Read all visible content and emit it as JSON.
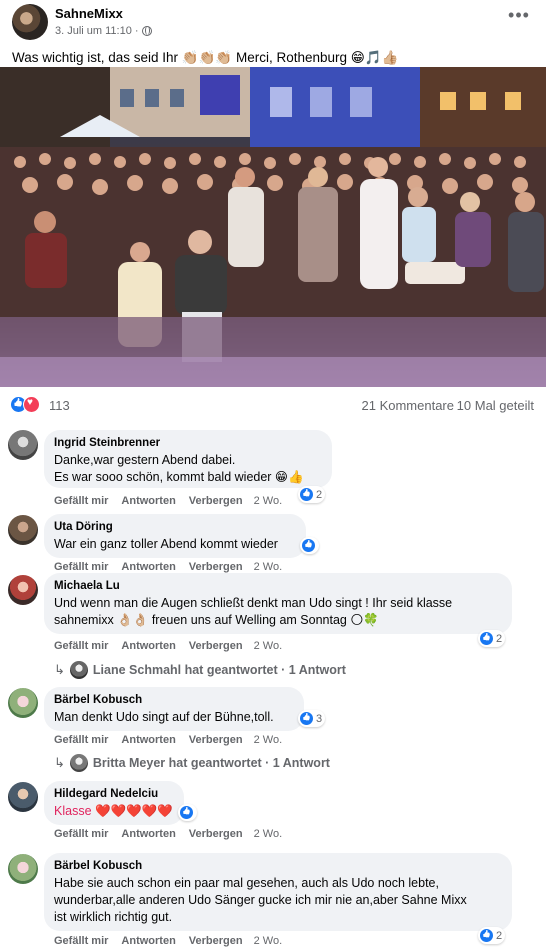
{
  "post": {
    "page_name": "SahneMixx",
    "date": "3. Juli um 11:10",
    "dot": "·",
    "text": "Was wichtig ist, das seid Ihr 👏🏼👏🏼👏🏼 Merci, Rothenburg 😁🎵👍🏼",
    "more_icon": "more-options-icon"
  },
  "stats": {
    "reaction_count": "113",
    "comments": "21 Kommentare",
    "shares": "10 Mal geteilt"
  },
  "actions": {
    "like": "Gefällt mir",
    "reply": "Antworten",
    "hide": "Verbergen"
  },
  "comments": [
    {
      "name": "Ingrid Steinbrenner",
      "line1": "Danke,war gestern Abend dabei.",
      "line2": "Es war sooo schön, kommt bald wieder 😁👍",
      "time": "2 Wo.",
      "reactions": "2"
    },
    {
      "name": "Uta Döring",
      "line1": "War ein ganz toller Abend kommt wieder",
      "time": "2 Wo."
    },
    {
      "name": "Michaela Lu",
      "line1": "Und wenn man die Augen schließt denkt man Udo singt ! Ihr seid klasse",
      "line2": "sahnemixx 👌🏼👌🏼 freuen uns auf Welling am Sonntag 🌕🍀",
      "time": "2 Wo.",
      "reactions": "2",
      "reply_thread": "Liane Schmahl hat geantwortet · 1 Antwort"
    },
    {
      "name": "Bärbel Kobusch",
      "line1": "Man denkt Udo singt auf der Bühne,toll.",
      "time": "2 Wo.",
      "reactions": "3",
      "reply_thread": "Britta Meyer hat geantwortet · 1 Antwort"
    },
    {
      "name": "Hildegard Nedelciu",
      "line1": "Klasse ❤️❤️❤️❤️❤️",
      "time": "2 Wo."
    },
    {
      "name": "Bärbel Kobusch",
      "line1": "Habe sie auch schon ein paar mal gesehen, auch als Udo noch lebte,",
      "line2": "wunderbar,alle anderen Udo Sänger gucke ich mir nie an,aber Sahne Mixx",
      "line3": "ist wirklich richtig gut.",
      "time": "2 Wo.",
      "reactions": "2"
    }
  ],
  "colors": {
    "like_blue": "#1877f2",
    "love_red": "#f33e58",
    "bubble_bg": "#f0f2f5",
    "meta_gray": "#65676b"
  }
}
